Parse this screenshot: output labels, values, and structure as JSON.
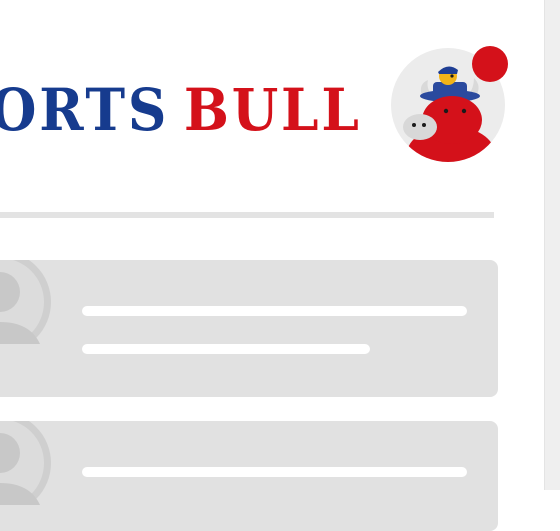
{
  "header": {
    "logo_part_1": "ORTS",
    "logo_part_2": "BULL",
    "brand_blue": "#163b8e",
    "brand_red": "#d4111a",
    "mascot_icon": "bull-mascot-icon",
    "notification_badge": "red-dot"
  },
  "feed": {
    "placeholder_color": "#e1e1e1",
    "avatar_icon": "user-avatar-icon",
    "cards": [
      "card-1",
      "card-2"
    ]
  }
}
